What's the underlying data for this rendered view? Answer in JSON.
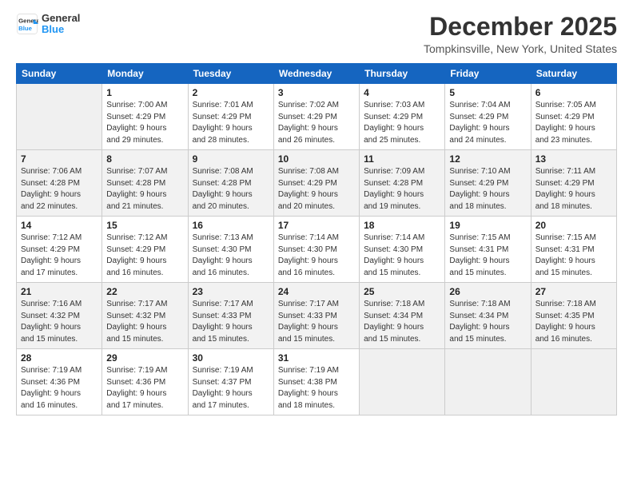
{
  "header": {
    "logo_line1": "General",
    "logo_line2": "Blue",
    "title": "December 2025",
    "subtitle": "Tompkinsville, New York, United States"
  },
  "calendar": {
    "days_of_week": [
      "Sunday",
      "Monday",
      "Tuesday",
      "Wednesday",
      "Thursday",
      "Friday",
      "Saturday"
    ],
    "weeks": [
      [
        {
          "day": "",
          "info": ""
        },
        {
          "day": "1",
          "info": "Sunrise: 7:00 AM\nSunset: 4:29 PM\nDaylight: 9 hours\nand 29 minutes."
        },
        {
          "day": "2",
          "info": "Sunrise: 7:01 AM\nSunset: 4:29 PM\nDaylight: 9 hours\nand 28 minutes."
        },
        {
          "day": "3",
          "info": "Sunrise: 7:02 AM\nSunset: 4:29 PM\nDaylight: 9 hours\nand 26 minutes."
        },
        {
          "day": "4",
          "info": "Sunrise: 7:03 AM\nSunset: 4:29 PM\nDaylight: 9 hours\nand 25 minutes."
        },
        {
          "day": "5",
          "info": "Sunrise: 7:04 AM\nSunset: 4:29 PM\nDaylight: 9 hours\nand 24 minutes."
        },
        {
          "day": "6",
          "info": "Sunrise: 7:05 AM\nSunset: 4:29 PM\nDaylight: 9 hours\nand 23 minutes."
        }
      ],
      [
        {
          "day": "7",
          "info": "Sunrise: 7:06 AM\nSunset: 4:28 PM\nDaylight: 9 hours\nand 22 minutes."
        },
        {
          "day": "8",
          "info": "Sunrise: 7:07 AM\nSunset: 4:28 PM\nDaylight: 9 hours\nand 21 minutes."
        },
        {
          "day": "9",
          "info": "Sunrise: 7:08 AM\nSunset: 4:28 PM\nDaylight: 9 hours\nand 20 minutes."
        },
        {
          "day": "10",
          "info": "Sunrise: 7:08 AM\nSunset: 4:29 PM\nDaylight: 9 hours\nand 20 minutes."
        },
        {
          "day": "11",
          "info": "Sunrise: 7:09 AM\nSunset: 4:28 PM\nDaylight: 9 hours\nand 19 minutes."
        },
        {
          "day": "12",
          "info": "Sunrise: 7:10 AM\nSunset: 4:29 PM\nDaylight: 9 hours\nand 18 minutes."
        },
        {
          "day": "13",
          "info": "Sunrise: 7:11 AM\nSunset: 4:29 PM\nDaylight: 9 hours\nand 18 minutes."
        }
      ],
      [
        {
          "day": "14",
          "info": "Sunrise: 7:12 AM\nSunset: 4:29 PM\nDaylight: 9 hours\nand 17 minutes."
        },
        {
          "day": "15",
          "info": "Sunrise: 7:12 AM\nSunset: 4:29 PM\nDaylight: 9 hours\nand 16 minutes."
        },
        {
          "day": "16",
          "info": "Sunrise: 7:13 AM\nSunset: 4:30 PM\nDaylight: 9 hours\nand 16 minutes."
        },
        {
          "day": "17",
          "info": "Sunrise: 7:14 AM\nSunset: 4:30 PM\nDaylight: 9 hours\nand 16 minutes."
        },
        {
          "day": "18",
          "info": "Sunrise: 7:14 AM\nSunset: 4:30 PM\nDaylight: 9 hours\nand 15 minutes."
        },
        {
          "day": "19",
          "info": "Sunrise: 7:15 AM\nSunset: 4:31 PM\nDaylight: 9 hours\nand 15 minutes."
        },
        {
          "day": "20",
          "info": "Sunrise: 7:15 AM\nSunset: 4:31 PM\nDaylight: 9 hours\nand 15 minutes."
        }
      ],
      [
        {
          "day": "21",
          "info": "Sunrise: 7:16 AM\nSunset: 4:32 PM\nDaylight: 9 hours\nand 15 minutes."
        },
        {
          "day": "22",
          "info": "Sunrise: 7:17 AM\nSunset: 4:32 PM\nDaylight: 9 hours\nand 15 minutes."
        },
        {
          "day": "23",
          "info": "Sunrise: 7:17 AM\nSunset: 4:33 PM\nDaylight: 9 hours\nand 15 minutes."
        },
        {
          "day": "24",
          "info": "Sunrise: 7:17 AM\nSunset: 4:33 PM\nDaylight: 9 hours\nand 15 minutes."
        },
        {
          "day": "25",
          "info": "Sunrise: 7:18 AM\nSunset: 4:34 PM\nDaylight: 9 hours\nand 15 minutes."
        },
        {
          "day": "26",
          "info": "Sunrise: 7:18 AM\nSunset: 4:34 PM\nDaylight: 9 hours\nand 15 minutes."
        },
        {
          "day": "27",
          "info": "Sunrise: 7:18 AM\nSunset: 4:35 PM\nDaylight: 9 hours\nand 16 minutes."
        }
      ],
      [
        {
          "day": "28",
          "info": "Sunrise: 7:19 AM\nSunset: 4:36 PM\nDaylight: 9 hours\nand 16 minutes."
        },
        {
          "day": "29",
          "info": "Sunrise: 7:19 AM\nSunset: 4:36 PM\nDaylight: 9 hours\nand 17 minutes."
        },
        {
          "day": "30",
          "info": "Sunrise: 7:19 AM\nSunset: 4:37 PM\nDaylight: 9 hours\nand 17 minutes."
        },
        {
          "day": "31",
          "info": "Sunrise: 7:19 AM\nSunset: 4:38 PM\nDaylight: 9 hours\nand 18 minutes."
        },
        {
          "day": "",
          "info": ""
        },
        {
          "day": "",
          "info": ""
        },
        {
          "day": "",
          "info": ""
        }
      ]
    ]
  }
}
